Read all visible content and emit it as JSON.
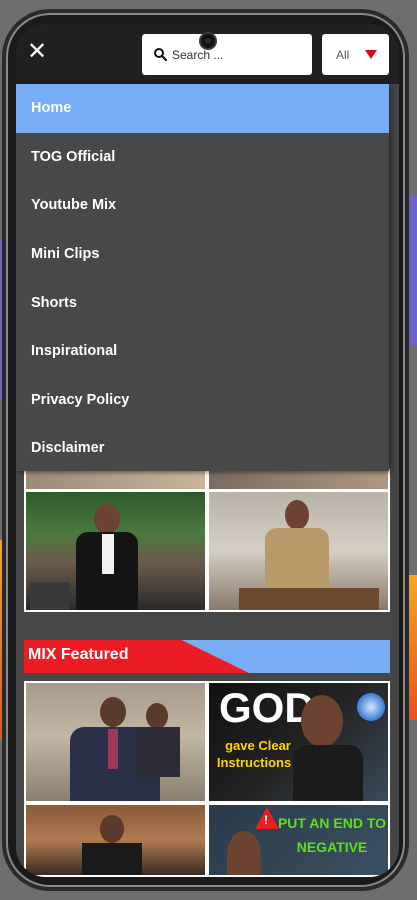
{
  "search": {
    "placeholder": "Search ..."
  },
  "filter": {
    "selected": "All"
  },
  "menu": {
    "items": [
      {
        "label": "Home",
        "active": true
      },
      {
        "label": "TOG Official",
        "active": false
      },
      {
        "label": "Youtube Mix",
        "active": false
      },
      {
        "label": "Mini Clips",
        "active": false
      },
      {
        "label": "Shorts",
        "active": false
      },
      {
        "label": "Inspirational",
        "active": false
      },
      {
        "label": "Privacy Policy",
        "active": false
      },
      {
        "label": "Disclaimer",
        "active": false
      }
    ]
  },
  "sections": {
    "mix_featured": {
      "title": "MIX Featured"
    }
  },
  "thumbnails": {
    "god_title": "GOD",
    "god_sub": "gave Clear Instructions !",
    "negative_text": "PUT AN END TO NEGATIVE"
  },
  "colors": {
    "accent_blue": "#76adf5",
    "accent_red": "#ec1c24",
    "menu_bg": "#484848",
    "topbar_bg": "#202020"
  },
  "icons": {
    "close": "close-icon",
    "search": "search-icon",
    "dropdown": "caret-down-icon"
  }
}
